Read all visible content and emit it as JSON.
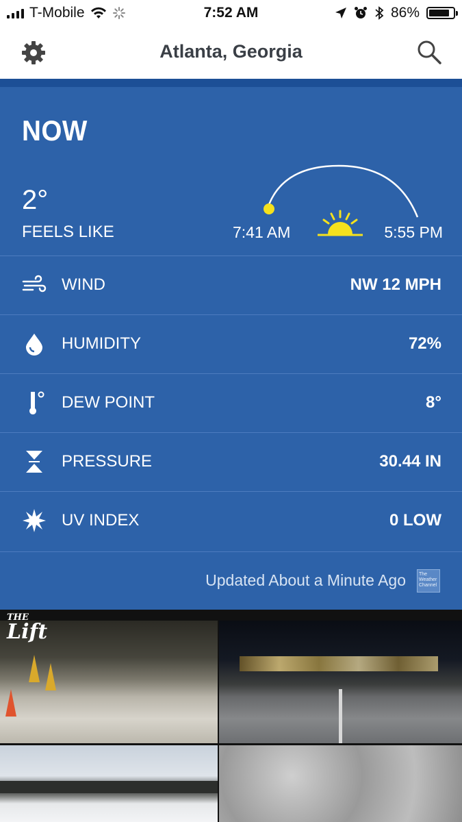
{
  "status_bar": {
    "carrier": "T-Mobile",
    "time": "7:52 AM",
    "battery_percent": "86%",
    "battery_level": 0.86
  },
  "nav": {
    "title": "Atlanta, Georgia",
    "settings_icon": "gear-icon",
    "search_icon": "search-icon"
  },
  "now": {
    "heading": "NOW",
    "temperature": "2°",
    "feels_like_label": "FEELS LIKE",
    "sunrise": "7:41 AM",
    "sunset": "5:55 PM"
  },
  "conditions": [
    {
      "icon": "wind-icon",
      "label": "WIND",
      "value": "NW 12 MPH"
    },
    {
      "icon": "humidity-drop-icon",
      "label": "HUMIDITY",
      "value": "72%"
    },
    {
      "icon": "thermometer-icon",
      "label": "DEW POINT",
      "value": "8°"
    },
    {
      "icon": "pressure-icon",
      "label": "PRESSURE",
      "value": "30.44 IN"
    },
    {
      "icon": "uv-sun-icon",
      "label": "UV INDEX",
      "value": "0 LOW"
    }
  ],
  "updated_text": "Updated About a Minute Ago",
  "logo_text": "The Weather Channel",
  "video": {
    "logo_the": "THE",
    "logo_name": "Lift"
  },
  "colors": {
    "panel": "#2d62a9",
    "strip": "#1c4f96",
    "sun": "#f5e11d"
  }
}
